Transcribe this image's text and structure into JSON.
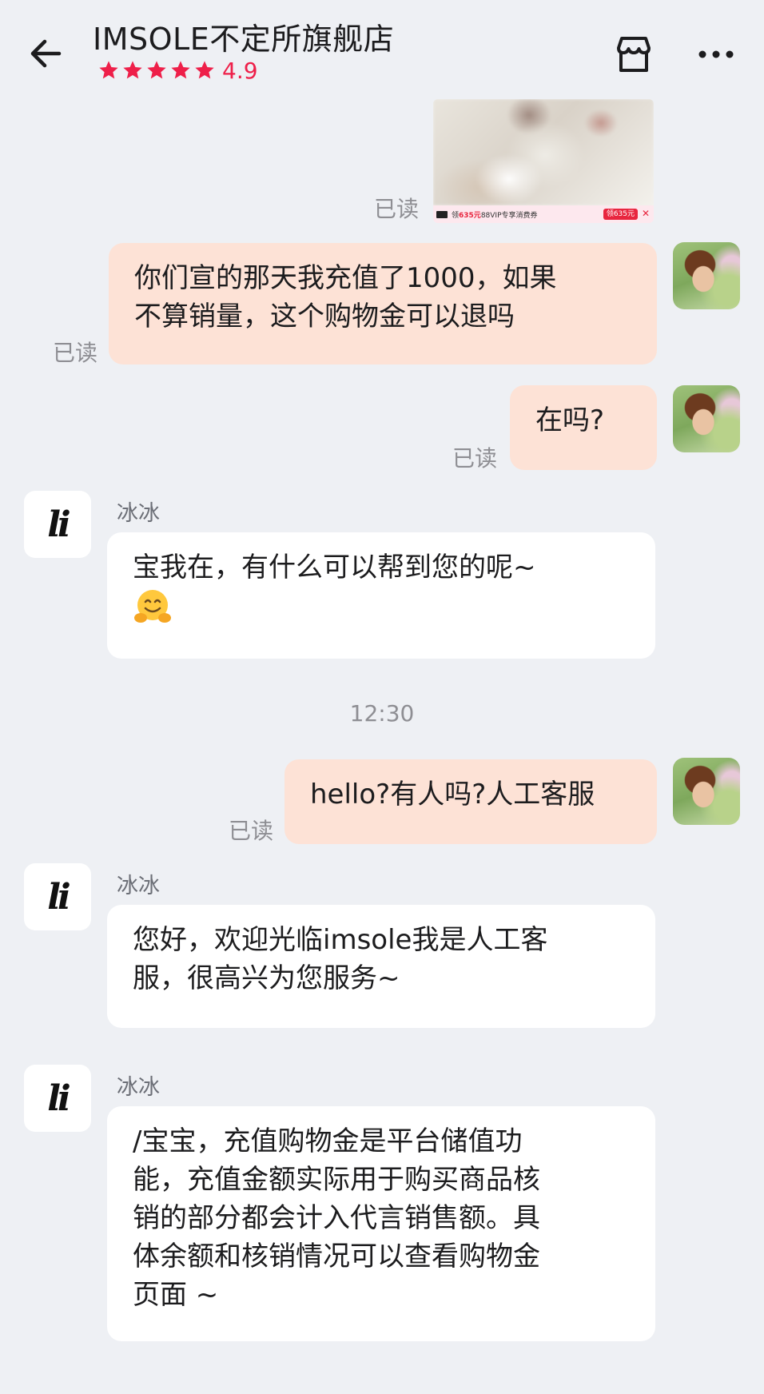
{
  "header": {
    "title": "IMSOLE不定所旗舰店",
    "rating": "4.9",
    "star_count": 5,
    "accent_color": "#ee1f49"
  },
  "messages": {
    "image_card": {
      "read": "已读",
      "banner_prefix": "领",
      "banner_amount": "635元",
      "banner_suffix": "88VIP专享消费券",
      "banner_button": "领635元",
      "banner_close": "✕"
    },
    "m1": {
      "read": "已读",
      "text_line1": "你们宣的那天我充值了1000，如果",
      "text_line2": "不算销量，这个购物金可以退吗"
    },
    "m2": {
      "read": "已读",
      "text": "在吗?"
    },
    "m3": {
      "name": "冰冰",
      "text_line1": "宝我在，有什么可以帮到您的呢~",
      "emoji": "hugging-face"
    },
    "timestamp": "12:30",
    "m4": {
      "read": "已读",
      "text": "hello?有人吗?人工客服"
    },
    "m5": {
      "name": "冰冰",
      "text_line1": "您好，欢迎光临imsole我是人工客",
      "text_line2": "服，很高兴为您服务~"
    },
    "m6": {
      "name": "冰冰",
      "text_line1": "/宝宝，充值购物金是平台储值功",
      "text_line2": "能，充值金额实际用于购买商品核",
      "text_line3": "销的部分都会计入代言销售额。具",
      "text_line4": "体余额和核销情况可以查看购物金",
      "text_line5": "页面 ~"
    }
  },
  "shop_logo": "li",
  "colors": {
    "background": "#eef0f4",
    "my_bubble": "#fde2d6",
    "their_bubble": "#ffffff",
    "read_text": "#8e8e93"
  }
}
